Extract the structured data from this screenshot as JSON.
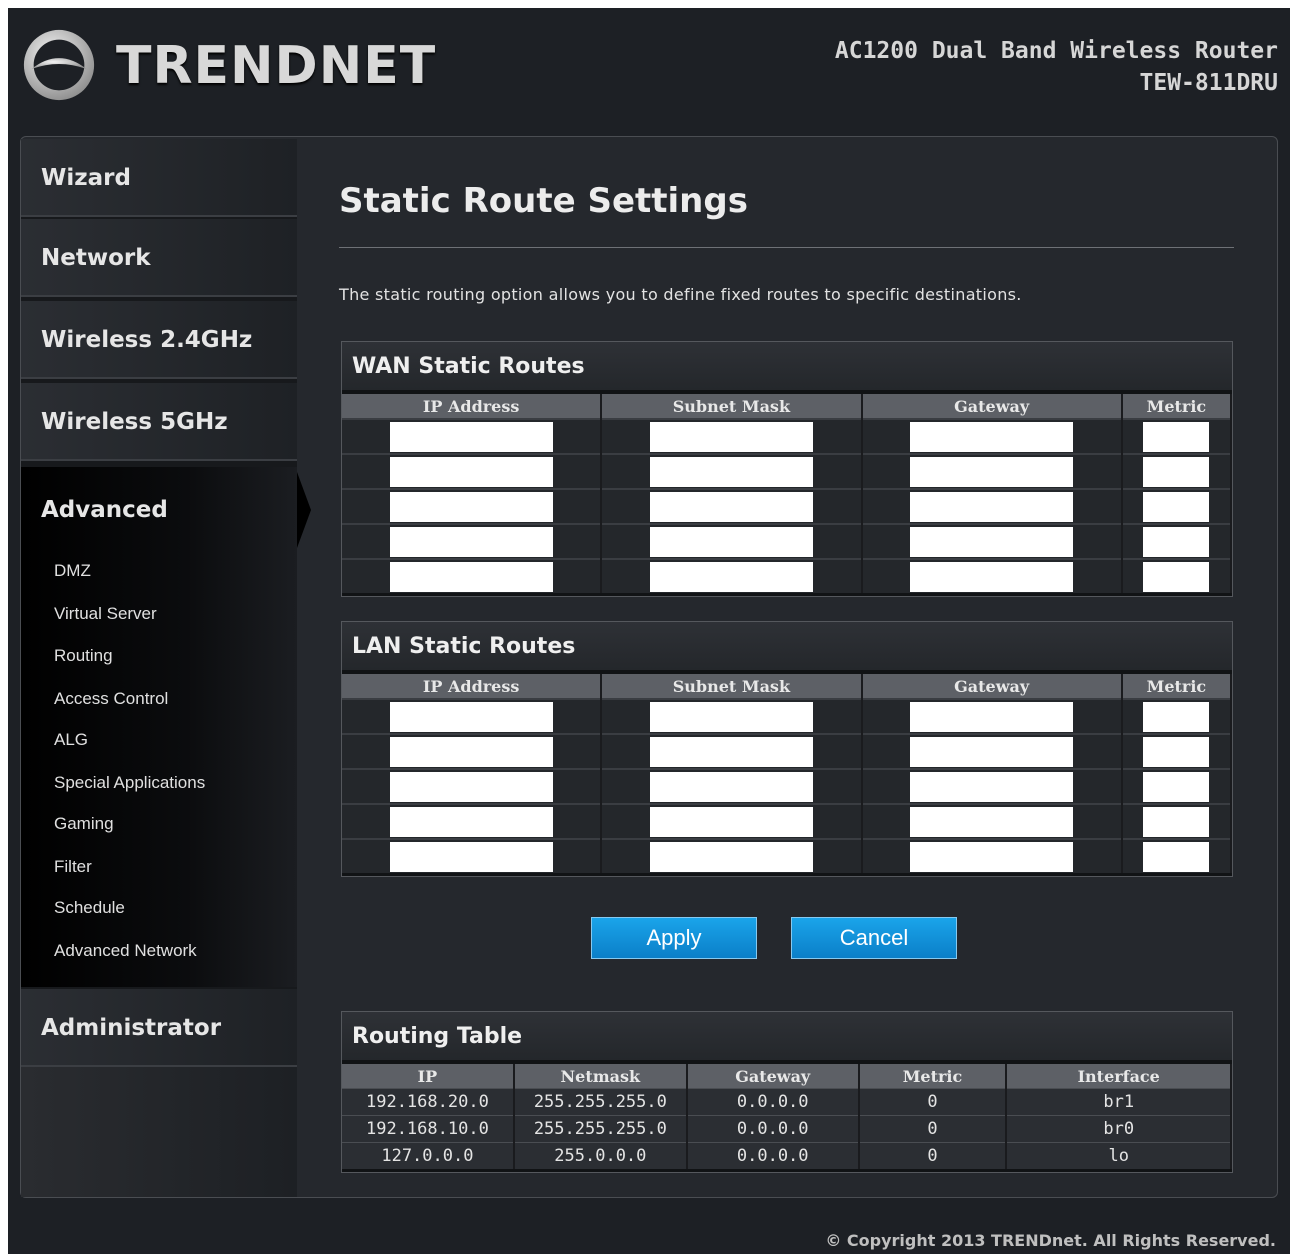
{
  "header": {
    "brand": "TRENDNET",
    "product_line": "AC1200 Dual Band Wireless Router",
    "model": "TEW-811DRU"
  },
  "sidebar": {
    "sections": [
      "Wizard",
      "Network",
      "Wireless 2.4GHz",
      "Wireless 5GHz",
      "Advanced",
      "Administrator"
    ],
    "active_section": "Advanced",
    "advanced_items": [
      "DMZ",
      "Virtual Server",
      "Routing",
      "Access Control",
      "ALG",
      "Special Applications",
      "Gaming",
      "Filter",
      "Schedule",
      "Advanced Network"
    ]
  },
  "main": {
    "title": "Static Route Settings",
    "description": "The static routing option allows you to define fixed routes to specific destinations.",
    "wan": {
      "title": "WAN Static Routes",
      "columns": [
        "IP Address",
        "Subnet Mask",
        "Gateway",
        "Metric"
      ]
    },
    "lan": {
      "title": "LAN Static Routes",
      "columns": [
        "IP Address",
        "Subnet Mask",
        "Gateway",
        "Metric"
      ]
    },
    "buttons": {
      "apply": "Apply",
      "cancel": "Cancel"
    },
    "routing_table": {
      "title": "Routing Table",
      "columns": [
        "IP",
        "Netmask",
        "Gateway",
        "Metric",
        "Interface"
      ],
      "rows": [
        [
          "192.168.20.0",
          "255.255.255.0",
          "0.0.0.0",
          "0",
          "br1"
        ],
        [
          "192.168.10.0",
          "255.255.255.0",
          "0.0.0.0",
          "0",
          "br0"
        ],
        [
          "127.0.0.0",
          "255.0.0.0",
          "0.0.0.0",
          "0",
          "lo"
        ]
      ]
    }
  },
  "footer": {
    "copyright": "© Copyright 2013 TRENDnet. All Rights Reserved."
  },
  "colors": {
    "accent_button": "#1aa4ea",
    "background": "#1d2025"
  }
}
